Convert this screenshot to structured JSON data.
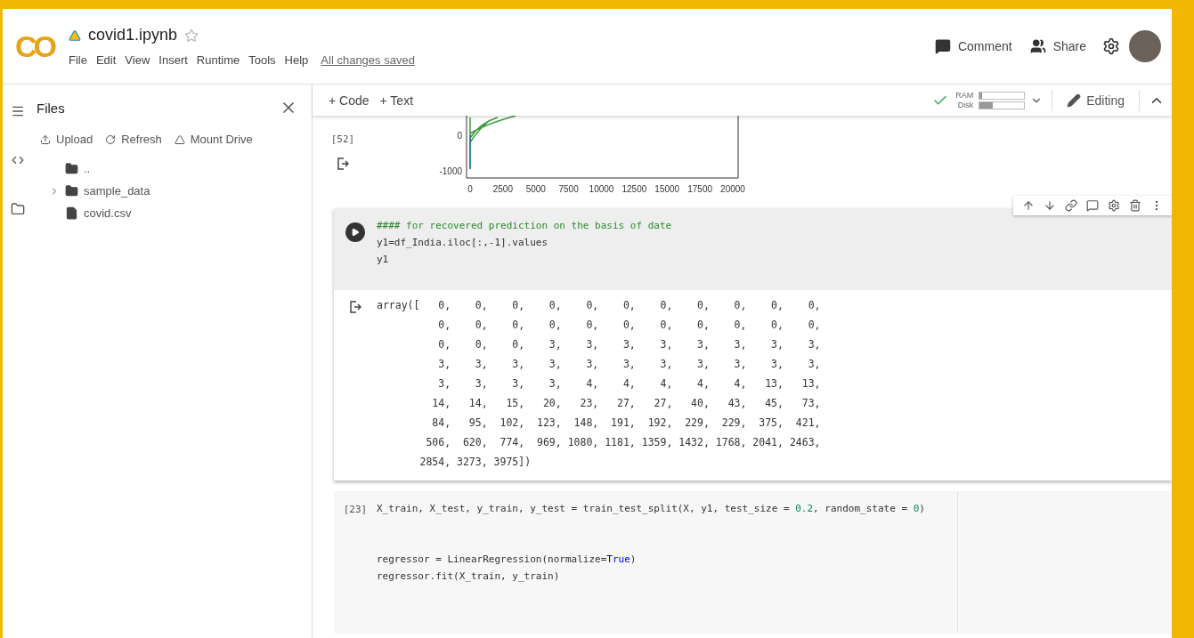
{
  "header": {
    "logo": "CO",
    "title": "covid1.ipynb",
    "starred": false,
    "menu": [
      "File",
      "Edit",
      "View",
      "Insert",
      "Runtime",
      "Tools",
      "Help"
    ],
    "save_status": "All changes saved",
    "actions": [
      {
        "kind": "comment",
        "label": "Comment"
      },
      {
        "kind": "share",
        "label": "Share"
      }
    ]
  },
  "toolbar": {
    "insert": [
      "+ Code",
      "+ Text"
    ],
    "connected": true,
    "meters": [
      {
        "label": "RAM",
        "level": 0.06
      },
      {
        "label": "Disk",
        "level": 0.3
      }
    ],
    "mode": "Editing"
  },
  "sidebar": {
    "title": "Files",
    "actions": [
      {
        "kind": "upload",
        "label": "Upload"
      },
      {
        "kind": "refresh",
        "label": "Refresh"
      },
      {
        "kind": "drive",
        "label": "Mount Drive"
      }
    ],
    "tree": [
      {
        "kind": "parent",
        "name": ".."
      },
      {
        "kind": "folder",
        "name": "sample_data",
        "expanded": false
      },
      {
        "kind": "file",
        "name": "covid.csv"
      }
    ]
  },
  "cells": [
    {
      "kind": "plot",
      "count": "[52]",
      "y_tick_labels": [
        "0",
        "-1000"
      ],
      "x_tick_labels": [
        "0",
        "2500",
        "5000",
        "7500",
        "10000",
        "12500",
        "15000",
        "17500",
        "20000"
      ]
    },
    {
      "kind": "code",
      "selected": true,
      "blocks": [
        [
          {
            "segments": [
              {
                "kind": "comment",
                "s": "#### for recovered prediction on the basis of date"
              }
            ]
          },
          {
            "segments": [
              {
                "kind": "plain",
                "s": "y1=df_India.iloc[:,-1].values"
              }
            ]
          },
          {
            "segments": [
              {
                "kind": "plain",
                "s": "y1"
              }
            ]
          }
        ]
      ],
      "output": [
        "array([   0,    0,    0,    0,    0,    0,    0,    0,    0,    0,    0,",
        "          0,    0,    0,    0,    0,    0,    0,    0,    0,    0,    0,",
        "          0,    0,    0,    3,    3,    3,    3,    3,    3,    3,    3,",
        "          3,    3,    3,    3,    3,    3,    3,    3,    3,    3,    3,",
        "          3,    3,    3,    3,    4,    4,    4,    4,    4,   13,   13,",
        "         14,   14,   15,   20,   23,   27,   27,   40,   43,   45,   73,",
        "         84,   95,  102,  123,  148,  191,  192,  229,  229,  375,  421,",
        "        506,  620,  774,  969, 1080, 1181, 1359, 1432, 1768, 2041, 2463,",
        "       2854, 3273, 3975])"
      ]
    },
    {
      "kind": "code",
      "selected": false,
      "count": "[23]",
      "blocks": [
        [
          {
            "segments": [
              {
                "kind": "plain",
                "s": "X_train, X_test, y_train, y_test = train_test_split(X, y1, test_size = "
              },
              {
                "kind": "number",
                "s": "0.2"
              },
              {
                "kind": "plain",
                "s": ", random_state = "
              },
              {
                "kind": "number",
                "s": "0"
              },
              {
                "kind": "plain",
                "s": ")"
              }
            ]
          }
        ],
        [
          {
            "segments": [
              {
                "kind": "plain",
                "s": "regressor = LinearRegression(normalize="
              },
              {
                "kind": "keyword",
                "s": "True"
              },
              {
                "kind": "plain",
                "s": ")"
              }
            ]
          },
          {
            "segments": [
              {
                "kind": "plain",
                "s": "regressor.fit(X_train, y_train)"
              }
            ]
          }
        ]
      ]
    }
  ]
}
